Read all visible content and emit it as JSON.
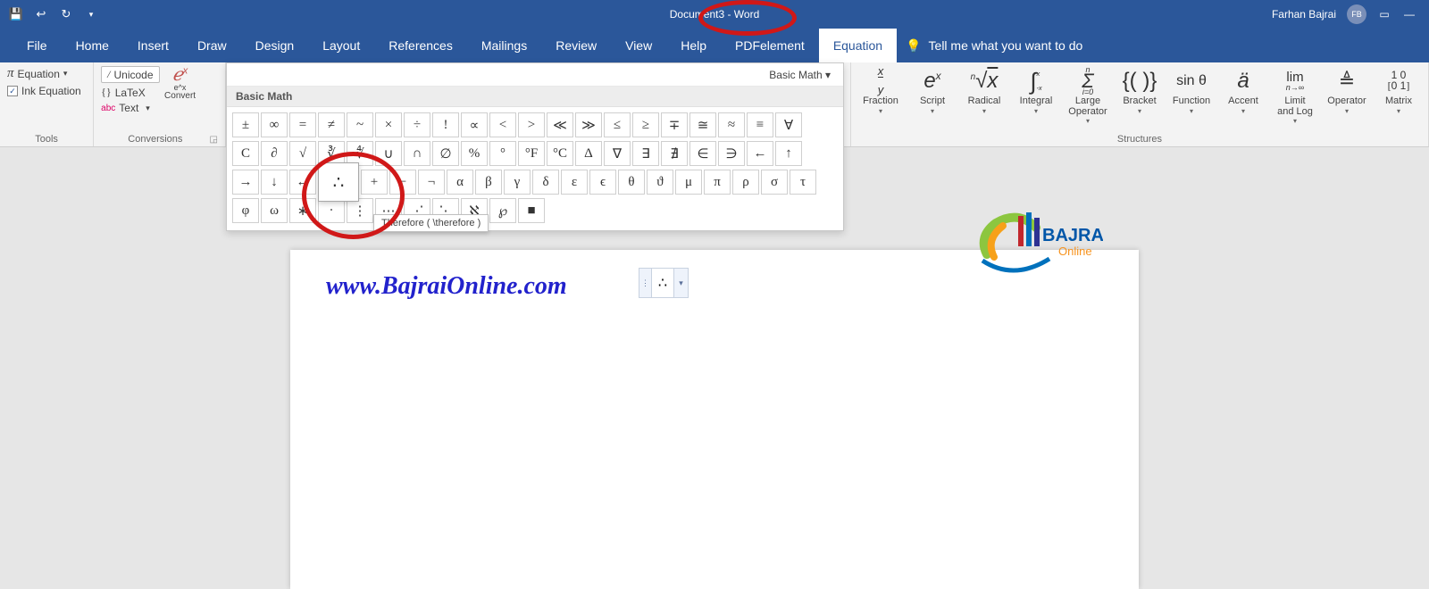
{
  "titlebar": {
    "doc_title": "Document3  -  Word",
    "user_name": "Farhan Bajrai",
    "user_initials": "FB"
  },
  "tabs": {
    "file": "File",
    "home": "Home",
    "insert": "Insert",
    "draw": "Draw",
    "design": "Design",
    "layout": "Layout",
    "references": "References",
    "mailings": "Mailings",
    "review": "Review",
    "view": "View",
    "help": "Help",
    "pdfelement": "PDFelement",
    "equation": "Equation",
    "tellme": "Tell me what you want to do"
  },
  "tools": {
    "equation_label": "Equation",
    "ink_equation": "Ink Equation",
    "group_label": "Tools"
  },
  "conversions": {
    "unicode": "Unicode",
    "latex": "LaTeX",
    "text": "Text",
    "convert": "Convert",
    "ex_sub": "e^x",
    "group_label": "Conversions",
    "abc": "abc"
  },
  "gallery": {
    "category": "Basic Math ▾",
    "heading": "Basic Math",
    "tooltip": "Therefore ( \\therefore )",
    "rows": [
      [
        "±",
        "∞",
        "=",
        "≠",
        "~",
        "×",
        "÷",
        "!",
        "∝",
        "<",
        ">",
        "≪",
        "≫",
        "≤",
        "≥",
        "∓",
        "≅",
        "≈",
        "≡",
        "∀"
      ],
      [
        "C",
        "∂",
        "√",
        "∛",
        "∜",
        "∪",
        "∩",
        "∅",
        "%",
        "°",
        "°F",
        "°C",
        "Δ",
        "∇",
        "∃",
        "∄",
        "∈",
        "∋",
        "←",
        "↑"
      ],
      [
        "→",
        "↓",
        "↔",
        "∴",
        "+",
        "−",
        "¬",
        "α",
        "β",
        "γ",
        "δ",
        "ε",
        "ϵ",
        "θ",
        "ϑ",
        "μ",
        "π",
        "ρ",
        "σ",
        "τ"
      ],
      [
        "φ",
        "ω",
        "∗",
        "∙",
        "⋮",
        "⋯",
        "⋰",
        "⋱",
        "ℵ",
        "℘",
        "■"
      ]
    ]
  },
  "structures": {
    "group_label": "Structures",
    "items": [
      {
        "glyph": "x/y",
        "label": "Fraction"
      },
      {
        "glyph": "eˣ",
        "label": "Script"
      },
      {
        "glyph": "ⁿ√x",
        "label": "Radical"
      },
      {
        "glyph": "∫ₓˣ",
        "label": "Integral"
      },
      {
        "glyph": "Σ",
        "label": "Large Operator"
      },
      {
        "glyph": "{()}",
        "label": "Bracket"
      },
      {
        "glyph": "sin θ",
        "label": "Function"
      },
      {
        "glyph": "ä",
        "label": "Accent"
      },
      {
        "glyph": "lim",
        "label": "Limit and Log"
      },
      {
        "glyph": "≜",
        "label": "Operator"
      },
      {
        "glyph": "[10\n01]",
        "label": "Matrix"
      }
    ]
  },
  "document": {
    "url_text": "www.BajraiOnline.com",
    "eq_content": "∴",
    "logo_top": "BAJRAI",
    "logo_sub": "Online"
  }
}
